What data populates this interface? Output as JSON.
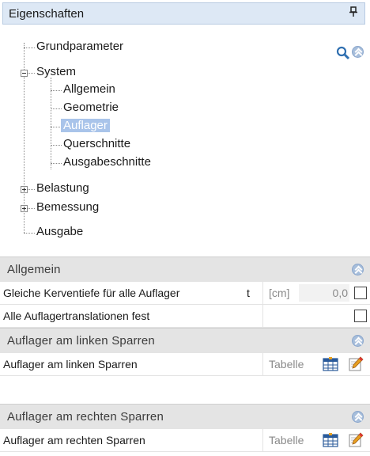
{
  "panel": {
    "title": "Eigenschaften",
    "pin_glyph": "ᵖ"
  },
  "tree": {
    "items": [
      {
        "label": "Grundparameter"
      },
      {
        "label": "System"
      },
      {
        "label": "Allgemein"
      },
      {
        "label": "Geometrie"
      },
      {
        "label": "Auflager"
      },
      {
        "label": "Querschnitte"
      },
      {
        "label": "Ausgabeschnitte"
      },
      {
        "label": "Belastung"
      },
      {
        "label": "Bemessung"
      },
      {
        "label": "Ausgabe"
      }
    ],
    "selected": "Auflager"
  },
  "sections": [
    {
      "title": "Allgemein",
      "rows": [
        {
          "label": "Gleiche Kerventiefe für alle Auflager",
          "symbol": "t",
          "unit": "[cm]",
          "value": "0,0"
        },
        {
          "label": "Alle Auflagertranslationen fest"
        }
      ]
    },
    {
      "title": "Auflager am linken Sparren",
      "rows": [
        {
          "label": "Auflager am linken Sparren",
          "mode": "Tabelle"
        }
      ]
    },
    {
      "title": "Auflager am rechten Sparren",
      "rows": [
        {
          "label": "Auflager am rechten Sparren",
          "mode": "Tabelle"
        }
      ]
    }
  ],
  "colors": {
    "titlebar": "#dde8f5",
    "selection": "#a9c4ea",
    "section_header": "#e4e4e4",
    "collapse_icon": "#a7bedb"
  }
}
